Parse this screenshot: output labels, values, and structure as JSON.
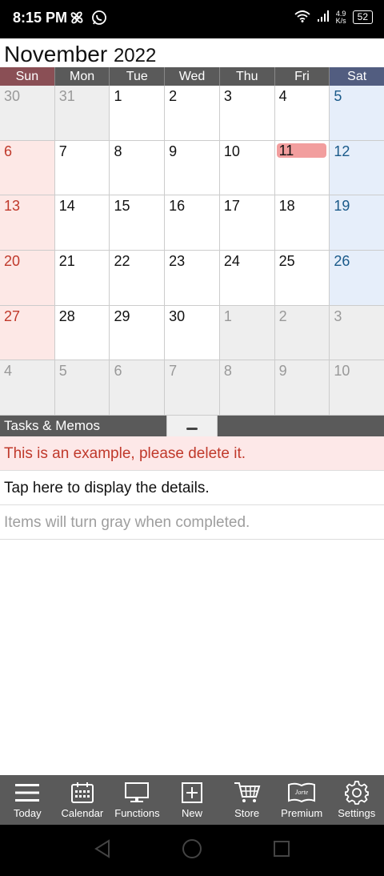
{
  "status_bar": {
    "time": "8:15 PM",
    "net_speed_value": "4.9",
    "net_speed_unit": "K/s",
    "battery": "52"
  },
  "calendar": {
    "month": "November",
    "year": "2022",
    "weekdays": [
      "Sun",
      "Mon",
      "Tue",
      "Wed",
      "Thu",
      "Fri",
      "Sat"
    ],
    "weekday_colors": [
      "#8a4f55",
      "#5a5a5a",
      "#5a5a5a",
      "#5a5a5a",
      "#5a5a5a",
      "#5a5a5a",
      "#525d80"
    ],
    "weeks": [
      [
        "30",
        "31",
        "1",
        "2",
        "3",
        "4",
        "5"
      ],
      [
        "6",
        "7",
        "8",
        "9",
        "10",
        "11",
        "12"
      ],
      [
        "13",
        "14",
        "15",
        "16",
        "17",
        "18",
        "19"
      ],
      [
        "20",
        "21",
        "22",
        "23",
        "24",
        "25",
        "26"
      ],
      [
        "27",
        "28",
        "29",
        "30",
        "1",
        "2",
        "3"
      ],
      [
        "4",
        "5",
        "6",
        "7",
        "8",
        "9",
        "10"
      ]
    ],
    "today": "11",
    "colors": {
      "sunday_text": "#c0392b",
      "saturday_text": "#1a5a8a",
      "sunday_bg": "#fde8e6",
      "saturday_bg": "#e6eefa",
      "other_month_bg": "#eeeeee",
      "other_month_text": "#999999",
      "today_highlight": "#f29e9e"
    }
  },
  "tasks": {
    "header": "Tasks & Memos",
    "items": [
      {
        "text": "This is an example, please delete it.",
        "color": "#c0392b",
        "bg": "#fde8e8"
      },
      {
        "text": "Tap here to display the details.",
        "color": "#111111",
        "bg": "#ffffff"
      },
      {
        "text": "Items will turn gray when completed.",
        "color": "#9e9e9e",
        "bg": "#ffffff"
      }
    ]
  },
  "bottom_nav": [
    {
      "label": "Today",
      "icon": "menu-icon"
    },
    {
      "label": "Calendar",
      "icon": "calendar-icon"
    },
    {
      "label": "Functions",
      "icon": "monitor-icon"
    },
    {
      "label": "New",
      "icon": "plus-box-icon"
    },
    {
      "label": "Store",
      "icon": "cart-icon"
    },
    {
      "label": "Premium",
      "icon": "jorte-book-icon"
    },
    {
      "label": "Settings",
      "icon": "gear-icon"
    }
  ],
  "premium_icon_text": "Jorte"
}
